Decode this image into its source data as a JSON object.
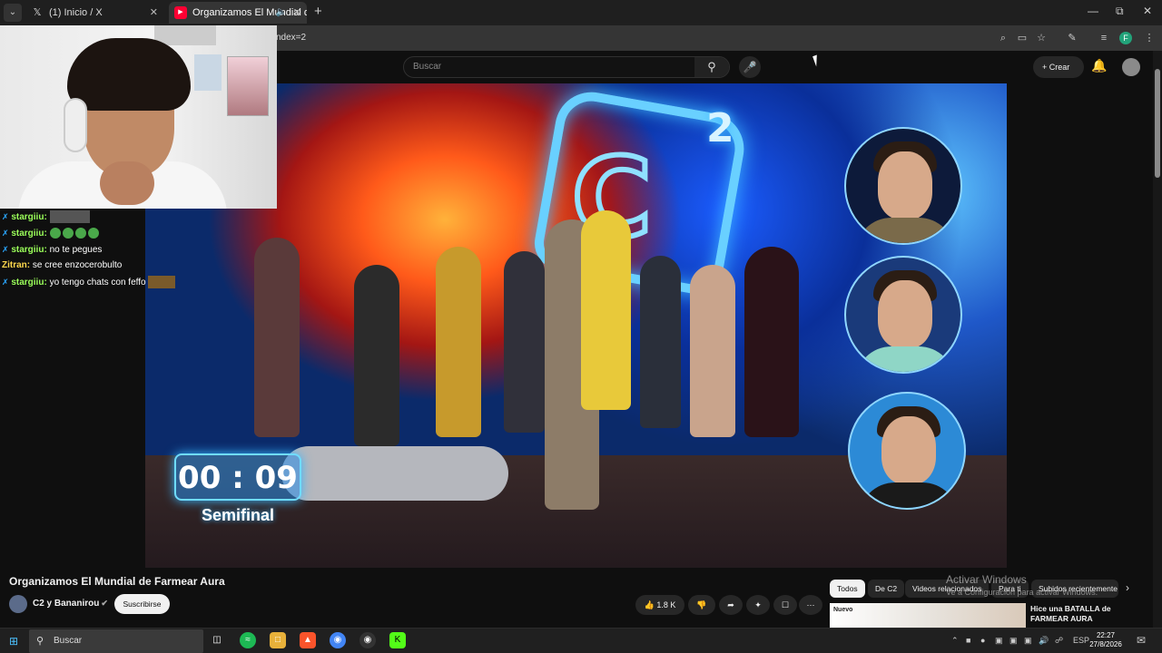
{
  "browser": {
    "tabs": [
      {
        "label": "(1) Inicio / X",
        "icon": "x-logo-icon"
      },
      {
        "label": "Organizamos El Mundial de",
        "icon": "youtube-icon"
      }
    ],
    "new_tab": "+",
    "url_fragment": "ndex=2",
    "profile_initial": "F"
  },
  "youtube": {
    "search_placeholder": "Buscar",
    "create_label": "Crear"
  },
  "video": {
    "timer": "00 : 09",
    "stage": "Semifinal",
    "logo_letter": "C",
    "logo_super": "2"
  },
  "chat": [
    {
      "user": "stargiiu:",
      "text": ""
    },
    {
      "user": "stargiiu:",
      "text": ""
    },
    {
      "user": "stargiiu:",
      "text": "no te pegues"
    },
    {
      "user": "Zitran:",
      "text": "se cree enzocerobulto"
    },
    {
      "user": "stargiiu:",
      "text": "yo tengo chats con feffo"
    }
  ],
  "watch": {
    "title": "Organizamos El Mundial de Farmear Aura",
    "channel": "C2 y Bananirou",
    "subscribe_label": "Suscribirse",
    "likes": "1.8 K"
  },
  "chips": [
    "Todos",
    "De C2",
    "Videos relacionados",
    "Para ti",
    "Subidos recientemente"
  ],
  "recommendation": {
    "badge": "Nuevo",
    "title": "Hice una BATALLA de FARMEAR AURA"
  },
  "windows_watermark": {
    "title": "Activar Windows",
    "subtitle": "Ve a Configuración para activar Windows."
  },
  "taskbar": {
    "search_placeholder": "Buscar",
    "language": "ESP",
    "time": "22:27",
    "date": "27/8/2026"
  },
  "colors": {
    "youtube_red": "#ff0033",
    "accent_blue": "#3ea6ff",
    "chat_user_green": "#9bff5a",
    "chat_user_yellow": "#ffd84d"
  }
}
